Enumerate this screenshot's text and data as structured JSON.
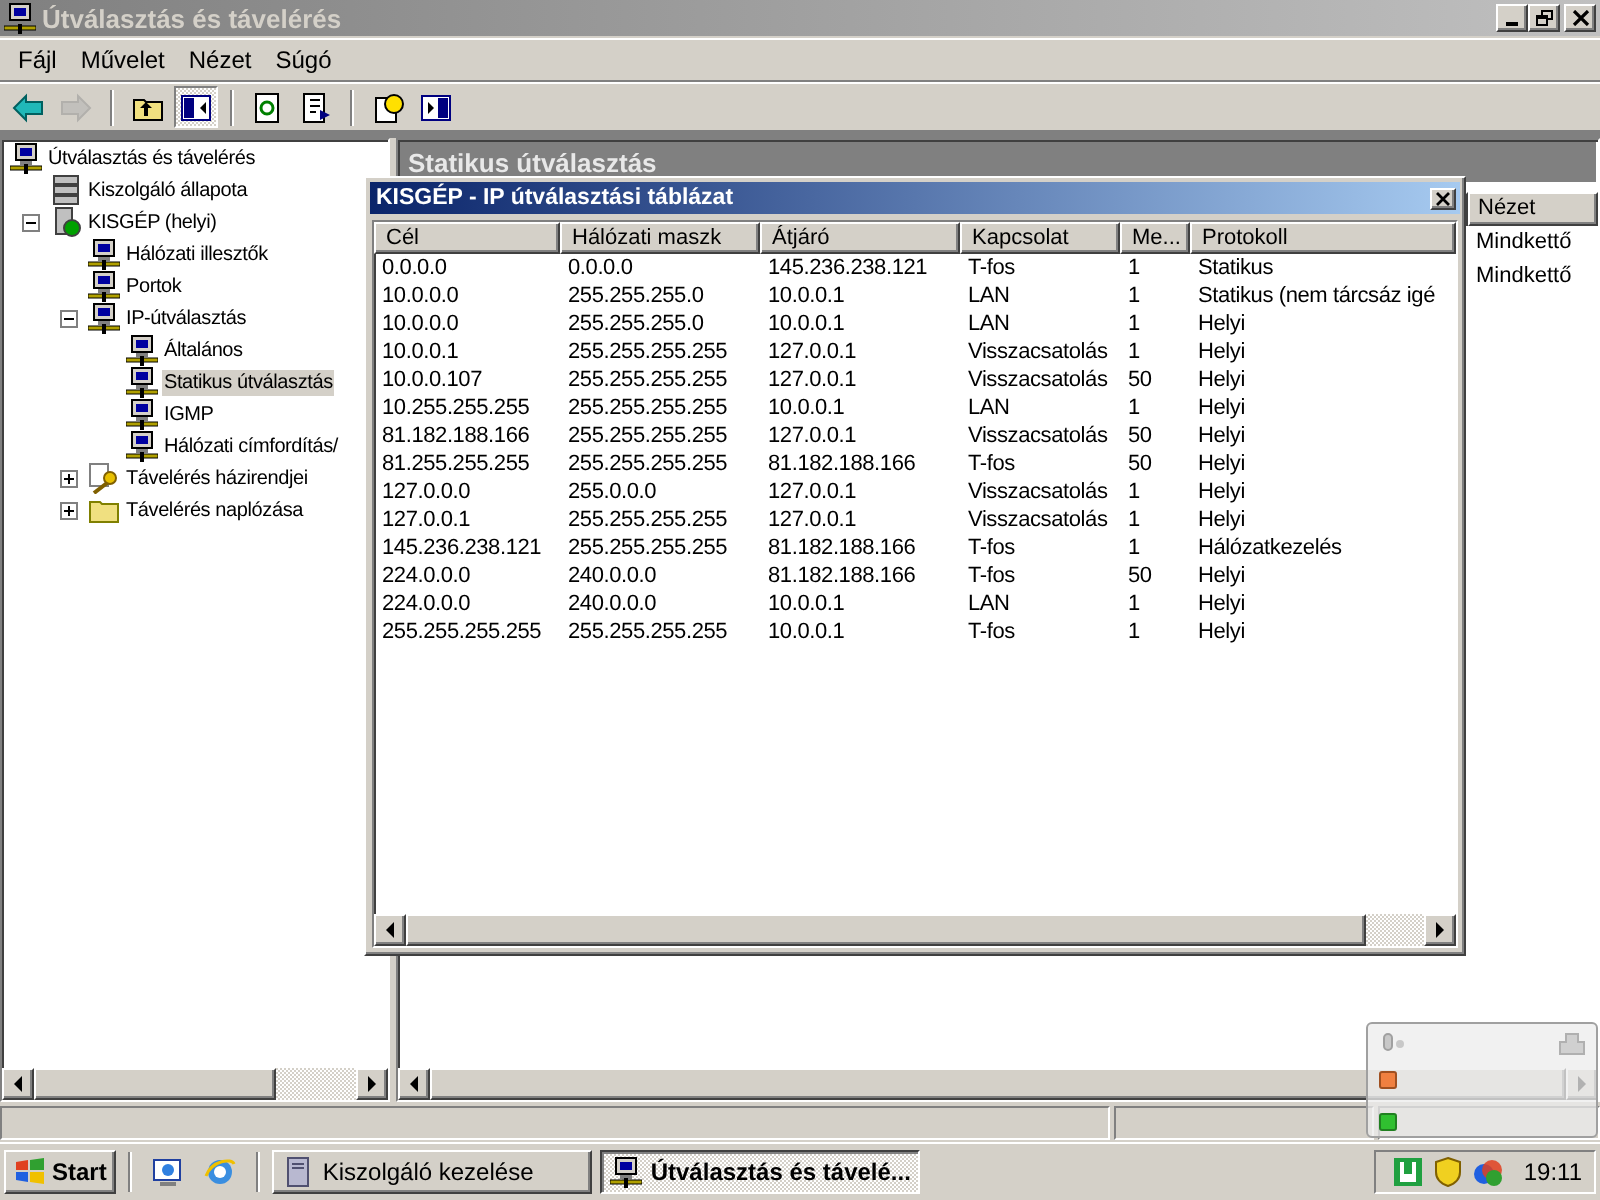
{
  "window": {
    "title": "Útválasztás és távelérés"
  },
  "menu": [
    "Fájl",
    "Művelet",
    "Nézet",
    "Súgó"
  ],
  "toolbar": [
    [
      {
        "kind": "back",
        "disabled": false,
        "pressed": false
      },
      {
        "kind": "forward",
        "disabled": true,
        "pressed": false
      }
    ],
    [
      {
        "kind": "up",
        "disabled": false,
        "pressed": false
      },
      {
        "kind": "tree",
        "disabled": false,
        "pressed": true
      }
    ],
    [
      {
        "kind": "refresh",
        "disabled": false,
        "pressed": false
      },
      {
        "kind": "export",
        "disabled": false,
        "pressed": false
      }
    ],
    [
      {
        "kind": "help",
        "disabled": false,
        "pressed": false
      },
      {
        "kind": "pane",
        "disabled": false,
        "pressed": false
      }
    ]
  ],
  "tree": [
    {
      "label": "Útválasztás és távelérés",
      "kind": "computer",
      "selected": false,
      "children": [
        {
          "label": "Kiszolgáló állapota",
          "kind": "servers",
          "selected": false
        },
        {
          "label": "KISGÉP (helyi)",
          "kind": "server",
          "selected": false,
          "expanded": true,
          "children": [
            {
              "label": "Hálózati illesztők",
              "kind": "computer",
              "selected": false
            },
            {
              "label": "Portok",
              "kind": "computer",
              "selected": false
            },
            {
              "label": "IP-útválasztás",
              "kind": "computer",
              "selected": false,
              "expanded": true,
              "children": [
                {
                  "label": "Általános",
                  "kind": "computer",
                  "selected": false
                },
                {
                  "label": "Statikus útválasztás",
                  "kind": "computer",
                  "selected": true
                },
                {
                  "label": "IGMP",
                  "kind": "computer",
                  "selected": false
                },
                {
                  "label": "Hálózati címfordítás/",
                  "kind": "computer",
                  "selected": false
                }
              ]
            },
            {
              "label": "Távelérés házirendjei",
              "kind": "policy",
              "selected": false,
              "expanded": false
            },
            {
              "label": "Távelérés naplózása",
              "kind": "folder",
              "selected": false,
              "expanded": false
            }
          ]
        }
      ]
    }
  ],
  "details_pane": {
    "title": "Statikus útválasztás",
    "columns": [
      "Nézet"
    ],
    "rows": [
      [
        "Mindkettő"
      ],
      [
        "Mindkettő"
      ]
    ]
  },
  "dialog": {
    "title": "KISGÉP - IP útválasztási táblázat",
    "columns": [
      "Cél",
      "Hálózati maszk",
      "Átjáró",
      "Kapcsolat",
      "Me...",
      "Protokoll"
    ],
    "rows": [
      [
        "0.0.0.0",
        "0.0.0.0",
        "145.236.238.121",
        "T-fos",
        "1",
        "Statikus"
      ],
      [
        "10.0.0.0",
        "255.255.255.0",
        "10.0.0.1",
        "LAN",
        "1",
        "Statikus (nem tárcsáz igé"
      ],
      [
        "10.0.0.0",
        "255.255.255.0",
        "10.0.0.1",
        "LAN",
        "1",
        "Helyi"
      ],
      [
        "10.0.0.1",
        "255.255.255.255",
        "127.0.0.1",
        "Visszacsatolás",
        "1",
        "Helyi"
      ],
      [
        "10.0.0.107",
        "255.255.255.255",
        "127.0.0.1",
        "Visszacsatolás",
        "50",
        "Helyi"
      ],
      [
        "10.255.255.255",
        "255.255.255.255",
        "10.0.0.1",
        "LAN",
        "1",
        "Helyi"
      ],
      [
        "81.182.188.166",
        "255.255.255.255",
        "127.0.0.1",
        "Visszacsatolás",
        "50",
        "Helyi"
      ],
      [
        "81.255.255.255",
        "255.255.255.255",
        "81.182.188.166",
        "T-fos",
        "50",
        "Helyi"
      ],
      [
        "127.0.0.0",
        "255.0.0.0",
        "127.0.0.1",
        "Visszacsatolás",
        "1",
        "Helyi"
      ],
      [
        "127.0.0.1",
        "255.255.255.255",
        "127.0.0.1",
        "Visszacsatolás",
        "1",
        "Helyi"
      ],
      [
        "145.236.238.121",
        "255.255.255.255",
        "81.182.188.166",
        "T-fos",
        "1",
        "Hálózatkezelés"
      ],
      [
        "224.0.0.0",
        "240.0.0.0",
        "81.182.188.166",
        "T-fos",
        "50",
        "Helyi"
      ],
      [
        "224.0.0.0",
        "240.0.0.0",
        "10.0.0.1",
        "LAN",
        "1",
        "Helyi"
      ],
      [
        "255.255.255.255",
        "255.255.255.255",
        "10.0.0.1",
        "T-fos",
        "1",
        "Helyi"
      ]
    ]
  },
  "taskbar": {
    "start": "Start",
    "tasks": [
      {
        "label": "Kiszolgáló kezelése",
        "kind": "server",
        "selected": false
      },
      {
        "label": "Útválasztás és távelé...",
        "kind": "computer",
        "selected": true
      }
    ],
    "clock": "19:11"
  }
}
